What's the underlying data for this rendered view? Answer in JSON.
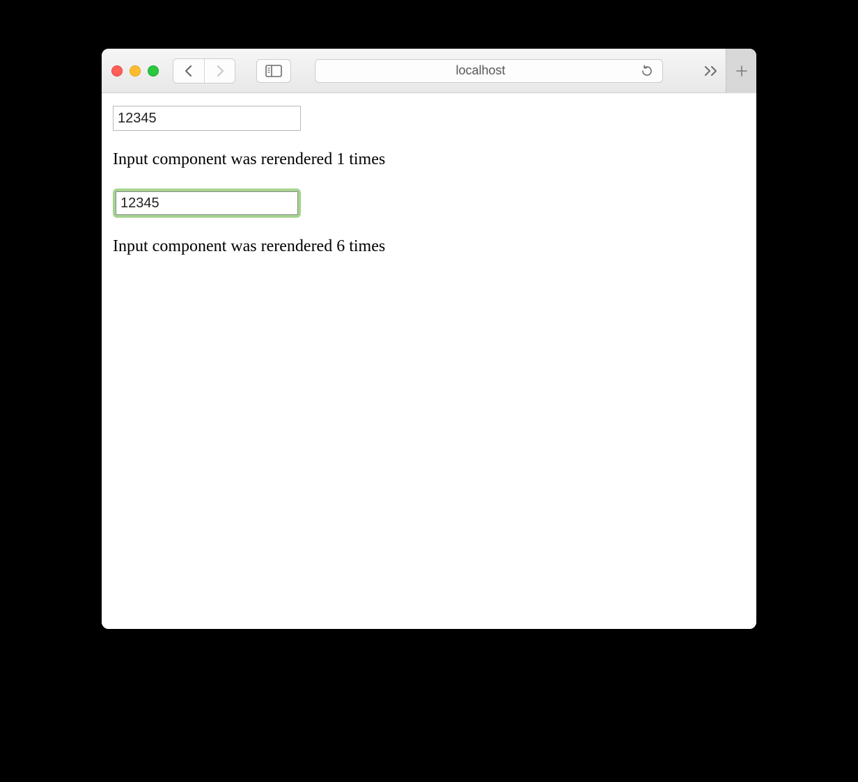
{
  "browser": {
    "address": "localhost"
  },
  "page": {
    "input1_value": "12345",
    "status1": "Input component was rerendered 1 times",
    "input2_value": "12345",
    "status2": "Input component was rerendered 6 times"
  }
}
